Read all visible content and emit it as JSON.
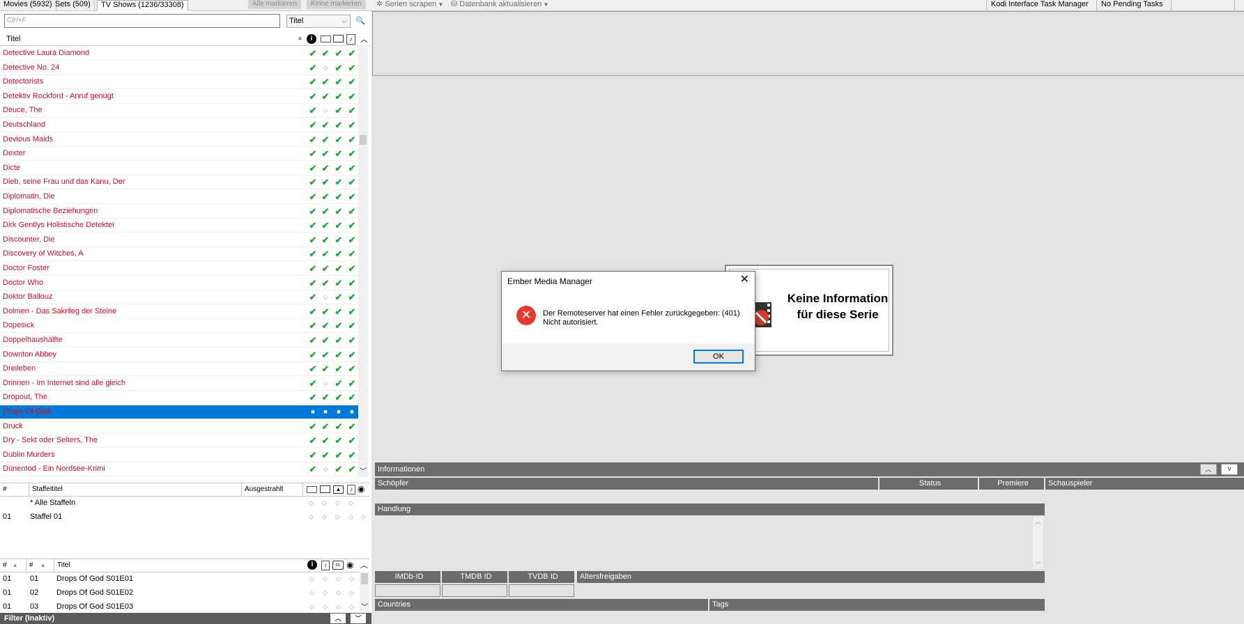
{
  "tabs": {
    "movies": "Movies (5932)",
    "sets": "Sets (509)",
    "tvshows": "TV Shows (1236/33308)"
  },
  "toolbar": {
    "mark_all": "Alle markieren",
    "mark_none": "Keine markieren",
    "scrape_series": "Serien scrapen",
    "update_db": "Datenbank aktualisieren",
    "task_manager": "Kodi Interface Task Manager",
    "pending": "No Pending Tasks"
  },
  "search": {
    "placeholder": "Ctrl+F",
    "sort_value": "Titel"
  },
  "list": {
    "header_title": "Titel",
    "rows": [
      {
        "title": "Detective Laura Diamond",
        "marks": [
          "c",
          "c",
          "c",
          "c"
        ]
      },
      {
        "title": "Detective No. 24",
        "marks": [
          "c",
          "d",
          "c",
          "c"
        ]
      },
      {
        "title": "Detectorists",
        "marks": [
          "c",
          "c",
          "c",
          "c"
        ]
      },
      {
        "title": "Detektiv Rockford - Anruf genügt",
        "marks": [
          "c",
          "c",
          "c",
          "c"
        ]
      },
      {
        "title": "Deuce, The",
        "marks": [
          "c",
          "d",
          "c",
          "c"
        ]
      },
      {
        "title": "Deutschland",
        "marks": [
          "c",
          "c",
          "c",
          "c"
        ]
      },
      {
        "title": "Devious Maids",
        "marks": [
          "c",
          "c",
          "c",
          "c"
        ]
      },
      {
        "title": "Dexter",
        "marks": [
          "c",
          "c",
          "c",
          "c"
        ]
      },
      {
        "title": "Dicte",
        "marks": [
          "c",
          "c",
          "c",
          "c"
        ]
      },
      {
        "title": "Dieb, seine Frau und das Kanu, Der",
        "marks": [
          "c",
          "c",
          "c",
          "c"
        ]
      },
      {
        "title": "Diplomatin, Die",
        "marks": [
          "c",
          "c",
          "c",
          "c"
        ]
      },
      {
        "title": "Diplomatische Beziehungen",
        "marks": [
          "c",
          "c",
          "c",
          "c"
        ]
      },
      {
        "title": "Dirk Gentlys Holistische Detektei",
        "marks": [
          "c",
          "c",
          "c",
          "c"
        ]
      },
      {
        "title": "Discounter, Die",
        "marks": [
          "c",
          "c",
          "c",
          "c"
        ]
      },
      {
        "title": "Discovery of Witches, A",
        "marks": [
          "c",
          "c",
          "c",
          "c"
        ]
      },
      {
        "title": "Doctor Foster",
        "marks": [
          "c",
          "c",
          "c",
          "c"
        ]
      },
      {
        "title": "Doctor Who",
        "marks": [
          "c",
          "c",
          "c",
          "c"
        ]
      },
      {
        "title": "Doktor Ballouz",
        "marks": [
          "c",
          "d",
          "c",
          "c"
        ]
      },
      {
        "title": "Dolmen - Das Sakrileg der Steine",
        "marks": [
          "c",
          "c",
          "c",
          "c"
        ]
      },
      {
        "title": "Dopesick",
        "marks": [
          "c",
          "c",
          "c",
          "c"
        ]
      },
      {
        "title": "Doppelhaushälfte",
        "marks": [
          "c",
          "c",
          "c",
          "c"
        ]
      },
      {
        "title": "Downton Abbey",
        "marks": [
          "c",
          "c",
          "c",
          "c"
        ]
      },
      {
        "title": "Dreileben",
        "marks": [
          "c",
          "c",
          "c",
          "c"
        ]
      },
      {
        "title": "Drinnen - Im Internet sind alle gleich",
        "marks": [
          "c",
          "d",
          "c",
          "c"
        ]
      },
      {
        "title": "Dropout, The",
        "marks": [
          "c",
          "c",
          "c",
          "c"
        ]
      },
      {
        "title": "Drops Of God",
        "marks": [
          "d",
          "d",
          "d",
          "d"
        ],
        "selected": true
      },
      {
        "title": "Druck",
        "marks": [
          "c",
          "c",
          "c",
          "c"
        ]
      },
      {
        "title": "Dry - Sekt oder Selters, The",
        "marks": [
          "c",
          "c",
          "c",
          "c"
        ]
      },
      {
        "title": "Dublin Murders",
        "marks": [
          "c",
          "c",
          "c",
          "c"
        ]
      },
      {
        "title": "Dünentod - Ein Nordsee-Krimi",
        "marks": [
          "c",
          "d",
          "c",
          "c"
        ]
      }
    ]
  },
  "seasons": {
    "col_num": "#",
    "col_title": "Staffeltitel",
    "col_aired": "Ausgestrahlt",
    "rows": [
      {
        "num": "",
        "title": "* Alle Staffeln"
      },
      {
        "num": "01",
        "title": "Staffel 01"
      }
    ]
  },
  "episodes": {
    "col_season": "#",
    "col_ep": "#",
    "col_title": "Titel",
    "rows": [
      {
        "s": "01",
        "e": "01",
        "title": "Drops Of God S01E01"
      },
      {
        "s": "01",
        "e": "02",
        "title": "Drops Of God S01E02"
      },
      {
        "s": "01",
        "e": "03",
        "title": "Drops Of God S01E03"
      }
    ]
  },
  "filter": {
    "label": "Filter (Inaktiv)"
  },
  "noinfo": {
    "text": "Keine Information für diese Serie"
  },
  "dialog": {
    "title": "Ember Media Manager",
    "message_line1": "Der Remoteserver hat einen Fehler zurückgegeben: (401)",
    "message_line2": "Nicht autorisiert.",
    "ok": "OK"
  },
  "info": {
    "header": "Informationen",
    "schoepfer": "Schöpfer",
    "status": "Status",
    "premiere": "Premiere",
    "schauspieler": "Schauspieler",
    "handlung": "Handlung",
    "imdb": "IMDb-ID",
    "tmdb": "TMDB ID",
    "tvdb": "TVDB ID",
    "alters": "Altersfreigaben",
    "countries": "Countries",
    "tags": "Tags",
    "collapse_btn": "v"
  },
  "colors": {
    "accent": "#0078d7",
    "title_red": "#c8102e",
    "check_green": "#27a53a",
    "error_red": "#e23b2e"
  }
}
